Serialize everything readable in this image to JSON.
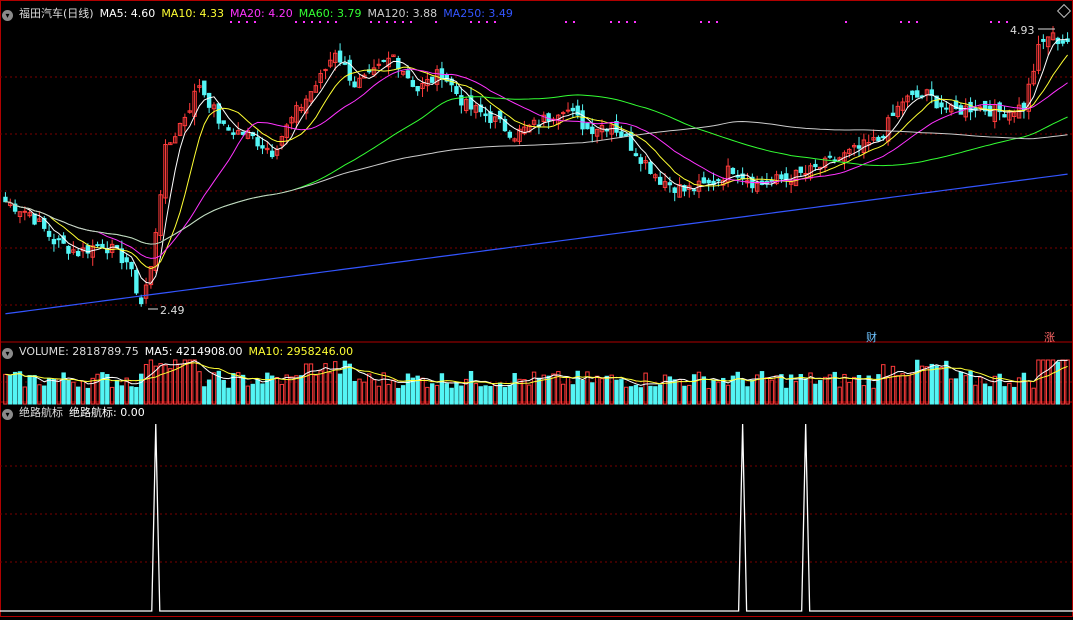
{
  "colors": {
    "up": "#ff3b3b",
    "down": "#54f5f5",
    "ma5": "#ffffff",
    "ma10": "#ffff33",
    "ma20": "#ff33ff",
    "ma60": "#33ff33",
    "ma120": "#cccccc",
    "ma250": "#3355ff",
    "grid": "#7a0000",
    "border": "#b00000",
    "signal": "#ffffff",
    "dots": "#ff33ff"
  },
  "main_header": {
    "title": "福田汽车(日线)",
    "ma5": "MA5: 4.60",
    "ma10": "MA10: 4.33",
    "ma20": "MA20: 4.20",
    "ma60": "MA60: 3.79",
    "ma120": "MA120: 3.88",
    "ma250": "MA250: 3.49"
  },
  "volume_header": {
    "title": "VOLUME: 2818789.75",
    "ma5": "MA5: 4214908.00",
    "ma10": "MA10: 2958246.00"
  },
  "indicator_header": {
    "title": "绝路航标",
    "value": "绝路航标: 0.00"
  },
  "labels": {
    "high": "4.93",
    "low": "2.49",
    "cai": "财",
    "zhang": "涨"
  },
  "chart_data": [
    {
      "type": "candlestick",
      "title": "福田汽车(日线)",
      "ylim": [
        2.35,
        5.05
      ],
      "series_names": [
        "MA5",
        "MA10",
        "MA20",
        "MA60",
        "MA120",
        "MA250"
      ],
      "anchors": [
        [
          0,
          3.45
        ],
        [
          5,
          3.35
        ],
        [
          10,
          3.1
        ],
        [
          15,
          3.0
        ],
        [
          20,
          3.08
        ],
        [
          25,
          2.92
        ],
        [
          28,
          2.55
        ],
        [
          30,
          2.85
        ],
        [
          33,
          3.9
        ],
        [
          38,
          4.3
        ],
        [
          40,
          4.5
        ],
        [
          45,
          4.1
        ],
        [
          50,
          4.05
        ],
        [
          55,
          3.9
        ],
        [
          60,
          4.25
        ],
        [
          65,
          4.55
        ],
        [
          68,
          4.8
        ],
        [
          72,
          4.5
        ],
        [
          75,
          4.55
        ],
        [
          80,
          4.75
        ],
        [
          85,
          4.45
        ],
        [
          90,
          4.6
        ],
        [
          95,
          4.3
        ],
        [
          100,
          4.2
        ],
        [
          105,
          4.05
        ],
        [
          110,
          4.15
        ],
        [
          115,
          4.3
        ],
        [
          120,
          4.1
        ],
        [
          125,
          4.15
        ],
        [
          130,
          3.9
        ],
        [
          135,
          3.65
        ],
        [
          140,
          3.55
        ],
        [
          145,
          3.6
        ],
        [
          150,
          3.75
        ],
        [
          155,
          3.6
        ],
        [
          160,
          3.65
        ],
        [
          165,
          3.7
        ],
        [
          170,
          3.8
        ],
        [
          175,
          3.9
        ],
        [
          180,
          4.0
        ],
        [
          185,
          4.35
        ],
        [
          190,
          4.4
        ],
        [
          195,
          4.25
        ],
        [
          200,
          4.3
        ],
        [
          205,
          4.25
        ],
        [
          210,
          4.3
        ],
        [
          213,
          4.8
        ],
        [
          215,
          4.93
        ],
        [
          218,
          4.88
        ]
      ],
      "high_label": 4.93,
      "low_label": 2.49
    },
    {
      "type": "bar",
      "title": "VOLUME",
      "series_names": [
        "VOLUME",
        "MA5",
        "MA10"
      ]
    },
    {
      "type": "line",
      "title": "绝路航标",
      "spikes_at": [
        31,
        152,
        165
      ],
      "ylim": [
        0,
        1
      ]
    }
  ]
}
